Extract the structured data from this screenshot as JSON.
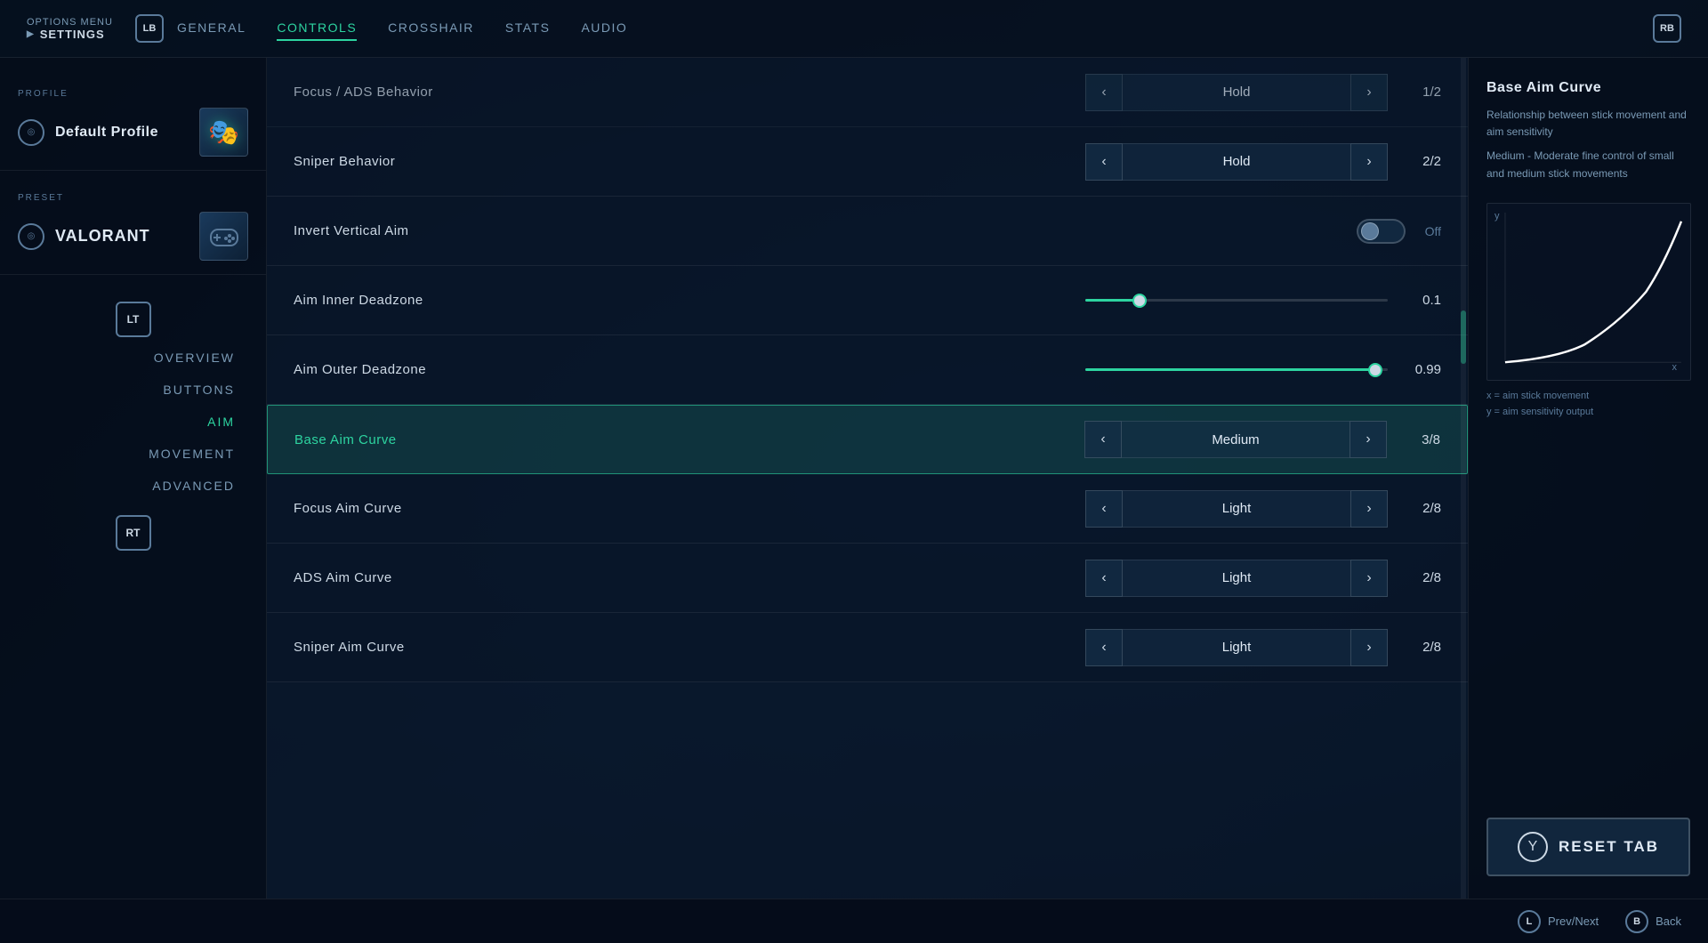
{
  "header": {
    "options_label": "OPTIONS MENU",
    "settings_label": "SETTINGS",
    "lb_label": "LB",
    "rb_label": "RB",
    "tabs": [
      {
        "id": "general",
        "label": "GENERAL",
        "active": false
      },
      {
        "id": "controls",
        "label": "CONTROLS",
        "active": true
      },
      {
        "id": "crosshair",
        "label": "CROSSHAIR",
        "active": false
      },
      {
        "id": "stats",
        "label": "STATS",
        "active": false
      },
      {
        "id": "audio",
        "label": "AUDIO",
        "active": false
      }
    ]
  },
  "sidebar": {
    "profile_label": "PROFILE",
    "profile_name": "Default Profile",
    "preset_label": "PRESET",
    "preset_name": "VALORANT",
    "lt_label": "LT",
    "rt_label": "RT",
    "nav_items": [
      {
        "id": "overview",
        "label": "OVERVIEW",
        "active": false
      },
      {
        "id": "buttons",
        "label": "BUTTONS",
        "active": false
      },
      {
        "id": "aim",
        "label": "AIM",
        "active": true
      },
      {
        "id": "movement",
        "label": "MOVEMENT",
        "active": false
      },
      {
        "id": "advanced",
        "label": "ADVANCED",
        "active": false
      }
    ]
  },
  "settings": {
    "rows": [
      {
        "id": "focus-ads-behavior",
        "label": "Focus / ADS Behavior",
        "control_type": "selector",
        "value": "Hold",
        "fraction": "1/2",
        "partial": true
      },
      {
        "id": "sniper-behavior",
        "label": "Sniper Behavior",
        "control_type": "selector",
        "value": "Hold",
        "fraction": "2/2"
      },
      {
        "id": "invert-vertical-aim",
        "label": "Invert Vertical Aim",
        "control_type": "toggle",
        "value": "Off"
      },
      {
        "id": "aim-inner-deadzone",
        "label": "Aim Inner Deadzone",
        "control_type": "slider",
        "value": "0.1",
        "fill_percent": 18
      },
      {
        "id": "aim-outer-deadzone",
        "label": "Aim Outer Deadzone",
        "control_type": "slider",
        "value": "0.99",
        "fill_percent": 96
      },
      {
        "id": "base-aim-curve",
        "label": "Base Aim Curve",
        "control_type": "selector",
        "value": "Medium",
        "fraction": "3/8",
        "highlighted": true
      },
      {
        "id": "focus-aim-curve",
        "label": "Focus Aim Curve",
        "control_type": "selector",
        "value": "Light",
        "fraction": "2/8"
      },
      {
        "id": "ads-aim-curve",
        "label": "ADS Aim Curve",
        "control_type": "selector",
        "value": "Light",
        "fraction": "2/8"
      },
      {
        "id": "sniper-aim-curve",
        "label": "Sniper Aim Curve",
        "control_type": "selector",
        "value": "Light",
        "fraction": "2/8"
      }
    ]
  },
  "right_panel": {
    "title": "Base Aim Curve",
    "description1": "Relationship between stick movement and aim sensitivity",
    "description2": "Medium - Moderate fine control of small and medium stick movements",
    "axis_x_label": "x",
    "axis_y_label": "y",
    "axis_desc_x": "x = aim stick movement",
    "axis_desc_y": "y = aim sensitivity output",
    "reset_label": "RESET TAB",
    "y_btn": "Y"
  },
  "bottom_bar": {
    "lb_label": "L",
    "prev_next": "Prev/Next",
    "b_label": "B",
    "back": "Back"
  },
  "colors": {
    "accent": "#2dd4a0",
    "highlight_bg": "rgba(30,130,110,0.25)",
    "text_primary": "#e0eaf5",
    "text_secondary": "#7a9ab5"
  }
}
